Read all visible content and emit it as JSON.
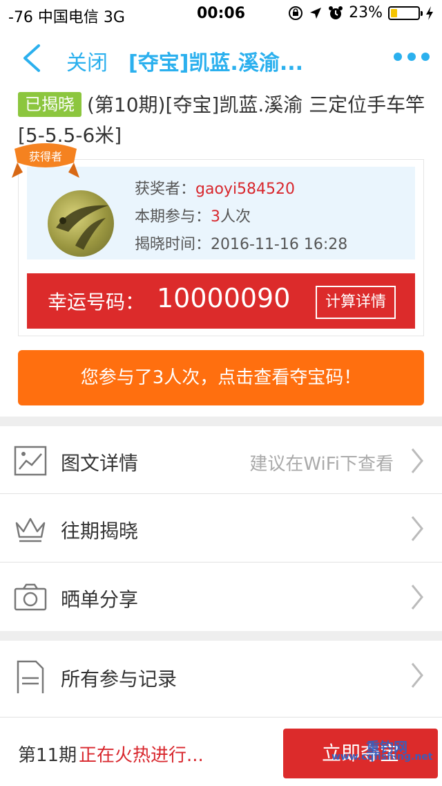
{
  "status_bar": {
    "carrier": "-76 中国电信   3G",
    "time": "00:06",
    "battery": "23%",
    "battery_level": 0.23
  },
  "nav": {
    "close_label": "关闭",
    "title": "[夺宝]凯蓝.溪渝..."
  },
  "product": {
    "tag": "已揭晓",
    "title": "(第10期)[夺宝]凯蓝.溪渝 三定位手车竿[5-5.5-6米]"
  },
  "winner": {
    "ribbon": "获得者",
    "winner_label": "获奖者：",
    "winner_name": "gaoyi584520",
    "participation_label": "本期参与：",
    "participation_count": "3",
    "participation_unit": "人次",
    "reveal_label": "揭晓时间：",
    "reveal_time": "2016-11-16 16:28"
  },
  "lucky": {
    "label": "幸运号码：",
    "number": "10000090",
    "calc_button": "计算详情"
  },
  "participation_button": "您参与了3人次，点击查看夺宝码！",
  "menu": [
    {
      "label": "图文详情",
      "hint": "建议在WiFi下查看",
      "icon": "image-icon"
    },
    {
      "label": "往期揭晓",
      "hint": "",
      "icon": "crown-icon"
    },
    {
      "label": "晒单分享",
      "hint": "",
      "icon": "camera-icon"
    },
    {
      "label": "所有参与记录",
      "hint": "",
      "icon": "document-icon"
    }
  ],
  "bottom": {
    "period": "第11期",
    "status": "正在火热进行...",
    "buy_button": "立即夺宝"
  },
  "watermark": {
    "name": "重钓网",
    "url": "www.cqfishing.net"
  },
  "colors": {
    "accent_blue": "#2bb0ee",
    "red": "#dc2b2b",
    "orange": "#ff6f0f",
    "green_tag": "#8cc63e"
  }
}
